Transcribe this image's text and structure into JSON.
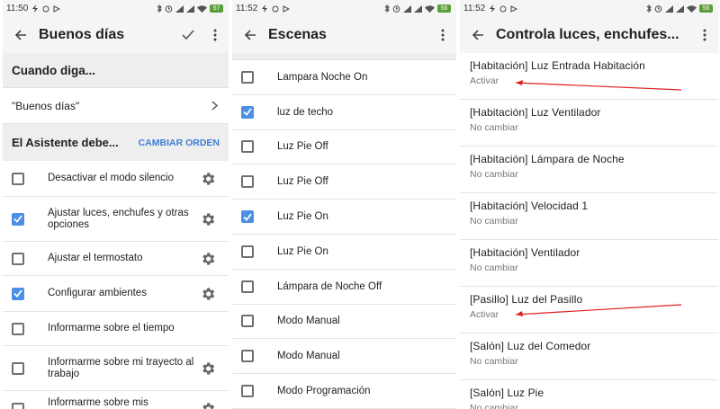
{
  "panel1": {
    "status": {
      "time": "11:50",
      "battery": "57"
    },
    "title": "Buenos días",
    "when_heading": "Cuando diga...",
    "phrase": "\"Buenos días\"",
    "assistant_heading": "El Asistente debe...",
    "change_order_label": "CAMBIAR ORDEN",
    "actions": [
      {
        "label": "Desactivar el modo silencio",
        "checked": false,
        "gear": true
      },
      {
        "label": "Ajustar luces, enchufes y otras opciones",
        "checked": true,
        "gear": true
      },
      {
        "label": "Ajustar el termostato",
        "checked": false,
        "gear": true
      },
      {
        "label": "Configurar ambientes",
        "checked": true,
        "gear": true
      },
      {
        "label": "Informarme sobre el tiempo",
        "checked": false,
        "gear": false
      },
      {
        "label": "Informarme sobre mi trayecto al trabajo",
        "checked": false,
        "gear": true
      },
      {
        "label": "Informarme sobre mis calendarios",
        "checked": false,
        "gear": true
      }
    ]
  },
  "panel2": {
    "status": {
      "time": "11:52",
      "battery": "56"
    },
    "title": "Escenas",
    "scenes": [
      {
        "label": "Lampara Noche On",
        "checked": false
      },
      {
        "label": "luz de techo",
        "checked": true
      },
      {
        "label": "Luz Pie Off",
        "checked": false
      },
      {
        "label": "Luz Pie Off",
        "checked": false
      },
      {
        "label": "Luz Pie On",
        "checked": true
      },
      {
        "label": "Luz Pie On",
        "checked": false
      },
      {
        "label": "Lámpara de Noche Off",
        "checked": false
      },
      {
        "label": "Modo Manual",
        "checked": false
      },
      {
        "label": "Modo Manual",
        "checked": false
      },
      {
        "label": "Modo Programación",
        "checked": false
      }
    ]
  },
  "panel3": {
    "status": {
      "time": "11:52",
      "battery": "56"
    },
    "title": "Controla luces, enchufes...",
    "devices": [
      {
        "name": "[Habitación] Luz Entrada Habitación",
        "state": "Activar"
      },
      {
        "name": "[Habitación] Luz Ventilador",
        "state": "No cambiar"
      },
      {
        "name": "[Habitación] Lámpara de Noche",
        "state": "No cambiar"
      },
      {
        "name": "[Habitación] Velocidad 1",
        "state": "No cambiar"
      },
      {
        "name": "[Habitación] Ventilador",
        "state": "No cambiar"
      },
      {
        "name": "[Pasillo] Luz del Pasillo",
        "state": "Activar"
      },
      {
        "name": "[Salón] Luz del Comedor",
        "state": "No cambiar"
      },
      {
        "name": "[Salón] Luz Pie",
        "state": "No cambiar"
      }
    ]
  },
  "colors": {
    "accent": "#4d8ee6",
    "link": "#3d7ed8",
    "annotation": "#e02020",
    "battery": "#5a9e3a"
  },
  "icons": [
    "back-arrow-icon",
    "check-icon",
    "more-vert-icon",
    "chevron-right-icon",
    "gear-icon",
    "bluetooth-icon",
    "alarm-icon",
    "signal-icon",
    "wifi-icon",
    "battery-icon",
    "flash-icon"
  ]
}
